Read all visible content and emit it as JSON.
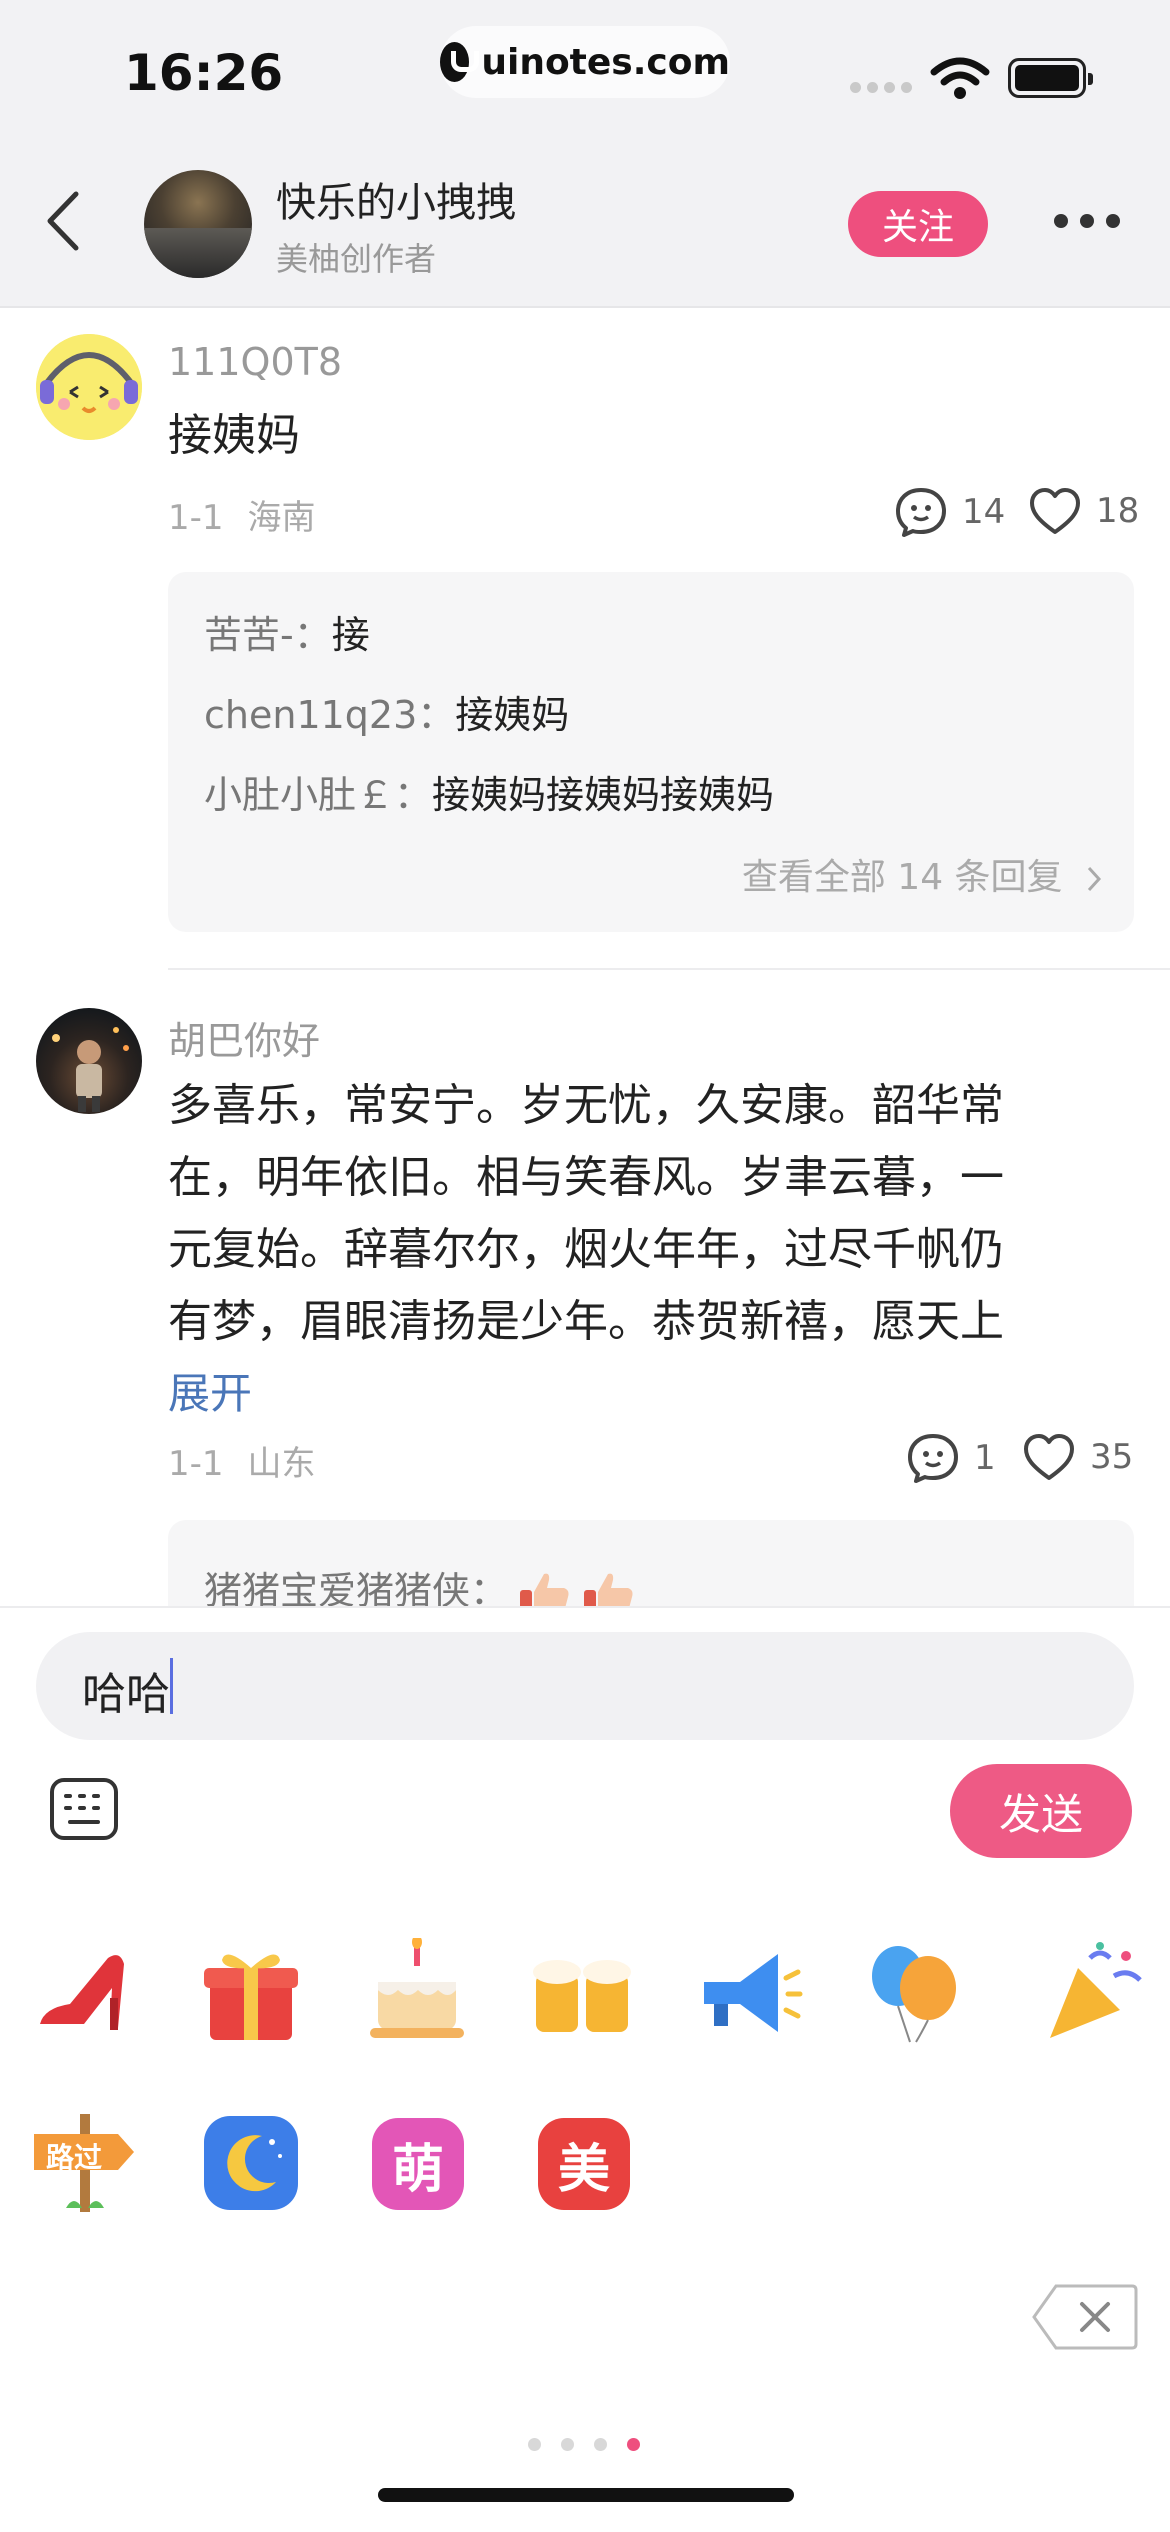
{
  "status_bar": {
    "time": "16:26",
    "url": "uinotes.com"
  },
  "nav": {
    "author_name": "快乐的小拽拽",
    "author_subtitle": "美柚创作者",
    "follow_label": "关注"
  },
  "comments": [
    {
      "username": "111Q0T8",
      "text": "接姨妈",
      "date": "1-1",
      "location": "海南",
      "reply_count": "14",
      "like_count": "18",
      "replies": [
        {
          "name": "苦苦-：",
          "text": "接"
        },
        {
          "name": "chen11q23：",
          "text": "接姨妈"
        },
        {
          "name": "小肚小肚￡：",
          "text": "接姨妈接姨妈接姨妈"
        }
      ],
      "view_all": "查看全部 14 条回复"
    },
    {
      "username": "胡巴你好",
      "text_lines": [
        "多喜乐，常安宁。岁无忧，久安康。韶华常",
        "在，明年依旧。相与笑春风。岁聿云暮，一",
        "元复始。辞暮尔尔，烟火年年，过尽千帆仍",
        "有梦，眉眼清扬是少年。恭贺新禧，愿天上"
      ],
      "expand_label": "展开",
      "date": "1-1",
      "location": "山东",
      "reply_count": "1",
      "like_count": "35",
      "replies": [
        {
          "name": "猪猪宝爱猪猪侠：",
          "text": ""
        }
      ]
    }
  ],
  "composer": {
    "input_value": "哈哈",
    "send_label": "发送"
  },
  "stickers": [
    {
      "name": "high-heel-sticker"
    },
    {
      "name": "gift-sticker"
    },
    {
      "name": "cake-sticker"
    },
    {
      "name": "beer-sticker"
    },
    {
      "name": "megaphone-sticker"
    },
    {
      "name": "balloon-sticker"
    },
    {
      "name": "party-popper-sticker"
    },
    {
      "name": "signpost-sticker",
      "text": "路过"
    },
    {
      "name": "moon-sticker"
    },
    {
      "name": "meng-sticker",
      "text": "萌"
    },
    {
      "name": "mei-sticker",
      "text": "美"
    }
  ],
  "colors": {
    "accent": "#ee4f7e",
    "link": "#4a76b8"
  }
}
